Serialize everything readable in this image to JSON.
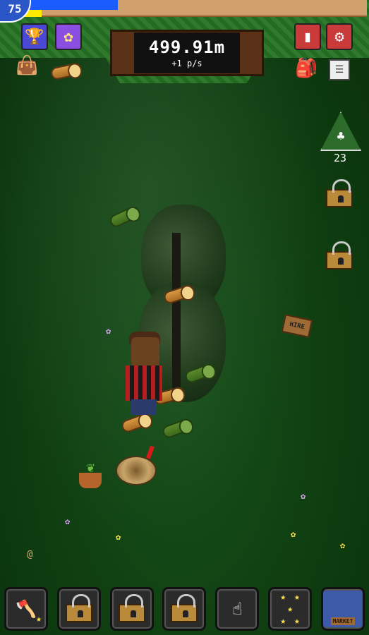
{
  "hud": {
    "level": "75",
    "score": "499.91m",
    "rate": "+1 p/s",
    "xp_progress_blue": 0.28,
    "xp_progress_yellow": 0.06
  },
  "right_panel": {
    "tree_upgrade_count": "23",
    "hire_sign_label": "HIRE"
  },
  "bottom_bar": {
    "market_label": "MARKET"
  },
  "icons": {
    "trophy": "trophy-icon",
    "flower": "flower-icon",
    "stats": "bar-chart-icon",
    "settings": "gear-icon",
    "fertilizer": "sack-icon",
    "log": "log-icon",
    "backpack": "backpack-icon",
    "notes": "notepad-icon"
  },
  "colors": {
    "xp_blue": "#1b5cff",
    "xp_yellow": "#ffeb00",
    "level_badge": "#2a56c8",
    "button_red": "#c93a3a",
    "button_purple": "#8a4ee0"
  }
}
